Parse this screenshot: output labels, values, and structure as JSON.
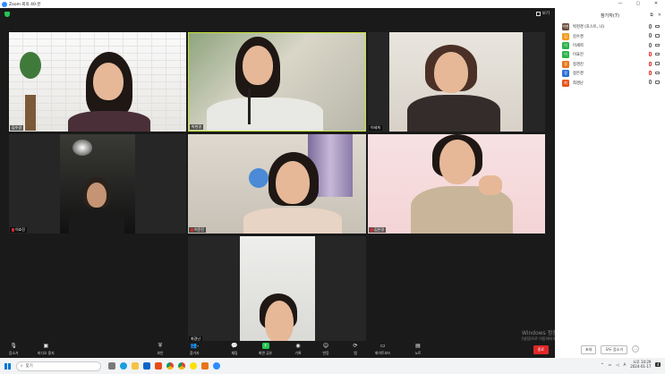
{
  "window": {
    "title": "Zoom 회의 40-분"
  },
  "meeting": {
    "view_label": "보기",
    "tiles": [
      {
        "name": "김수경",
        "muted": false
      },
      {
        "name": "박현경",
        "muted": false
      },
      {
        "name": "이세희",
        "muted": false
      },
      {
        "name": "이효진",
        "muted": true
      },
      {
        "name": "이윤진",
        "muted": true
      },
      {
        "name": "김은경",
        "muted": true
      },
      {
        "name": "최경난",
        "muted": false
      }
    ]
  },
  "toolbar": {
    "mute_label": "음소거",
    "video_label": "비디오 중지",
    "security_label": "보안",
    "participants_label": "참가자",
    "participants_count": "7",
    "chat_label": "채팅",
    "share_label": "화면 공유",
    "record_label": "기록",
    "reactions_label": "반응",
    "apps_label": "앱",
    "whiteboard_label": "화이트보드",
    "notes_label": "노트",
    "end_label": "종료"
  },
  "panel": {
    "title": "참가자(7)",
    "participants": [
      {
        "initial": "박현",
        "name": "박현경 (호스트, 나)",
        "color": "#6b4a3a",
        "mic_muted": false,
        "cam_off": false
      },
      {
        "initial": "김",
        "name": "김수경",
        "color": "#f29b1d",
        "mic_muted": false,
        "cam_off": false
      },
      {
        "initial": "이",
        "name": "이세희",
        "color": "#2bb34a",
        "mic_muted": false,
        "cam_off": false
      },
      {
        "initial": "이",
        "name": "이효진",
        "color": "#2bb34a",
        "mic_muted": true,
        "cam_off": false
      },
      {
        "initial": "정",
        "name": "정경진",
        "color": "#e8741c",
        "mic_muted": true,
        "cam_off": false
      },
      {
        "initial": "정",
        "name": "정은경",
        "color": "#2d6fd6",
        "mic_muted": true,
        "cam_off": false
      },
      {
        "initial": "최",
        "name": "최경난",
        "color": "#e8541c",
        "mic_muted": false,
        "cam_off": false
      }
    ],
    "invite_label": "초대",
    "mute_all_label": "모두 음소거",
    "more_label": "..."
  },
  "watermark": {
    "title": "Windows 정품 인증",
    "subtitle": "[설정]으로 이동하여 Windows를 정품 인증합니다."
  },
  "taskbar": {
    "search_placeholder": "찾기",
    "time": "오후 10:29",
    "date": "2024-01-17",
    "lang": "A",
    "notification_count": "4"
  },
  "colors": {
    "accent": "#2d8cff",
    "active_speaker": "#c6e23a",
    "danger": "#e02828",
    "share_green": "#23c552"
  }
}
